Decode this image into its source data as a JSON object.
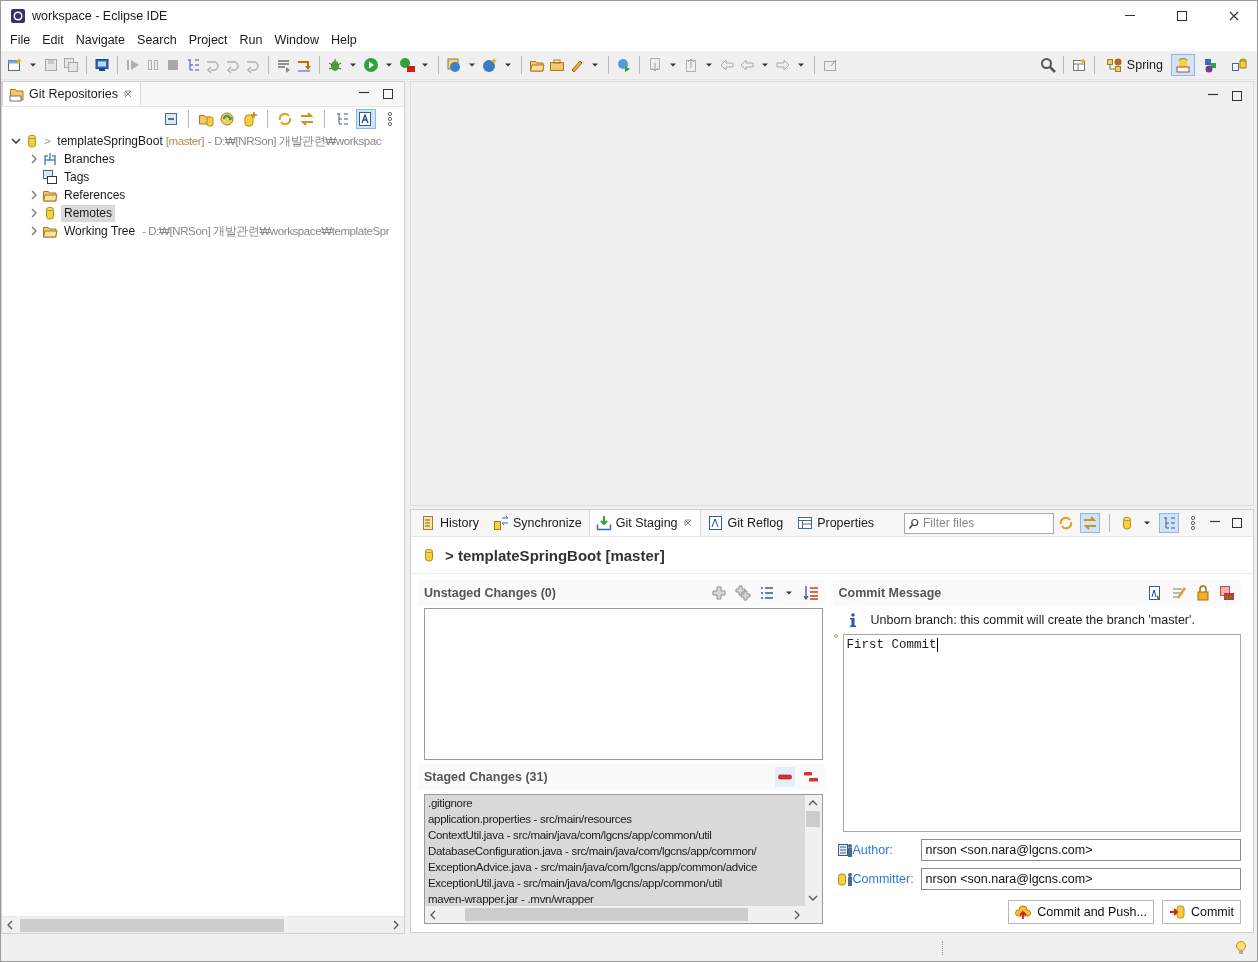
{
  "window": {
    "title": "workspace - Eclipse IDE"
  },
  "menu": [
    "File",
    "Edit",
    "Navigate",
    "Search",
    "Project",
    "Run",
    "Window",
    "Help"
  ],
  "perspectives": [
    {
      "label": "Spring",
      "selected": false,
      "kind": "spring"
    },
    {
      "selected": true,
      "kind": "git"
    },
    {
      "selected": false,
      "kind": "debug"
    },
    {
      "selected": false,
      "kind": "java"
    }
  ],
  "repositories_view": {
    "tab": {
      "label": "Git Repositories",
      "selected": true
    },
    "link_toggle_on": true,
    "tree": [
      {
        "prefix": ">",
        "label": "templateSpringBoot",
        "branch": "[master]",
        "path": "- D:₩[NRSon] 개발관련₩workspac",
        "kind": "repo",
        "expanded": true,
        "selected": false,
        "children": [
          {
            "label": "Branches",
            "kind": "branches",
            "expanded": false,
            "selected": false
          },
          {
            "label": "Tags",
            "kind": "tags",
            "selected": false
          },
          {
            "label": "References",
            "kind": "folder",
            "expanded": false,
            "selected": false
          },
          {
            "label": "Remotes",
            "kind": "remotes",
            "expanded": false,
            "selected": true
          },
          {
            "label": "Working Tree",
            "path": "- D:₩[NRSon] 개발관련₩workspace₩templateSpr",
            "kind": "folder",
            "expanded": false,
            "selected": false
          }
        ]
      }
    ]
  },
  "staging_view": {
    "tabs": [
      {
        "label": "History",
        "kind": "history",
        "selected": false
      },
      {
        "label": "Synchronize",
        "kind": "sync",
        "selected": false
      },
      {
        "label": "Git Staging",
        "kind": "staging",
        "selected": true
      },
      {
        "label": "Git Reflog",
        "kind": "reflog",
        "selected": false
      },
      {
        "label": "Properties",
        "kind": "properties",
        "selected": false
      }
    ],
    "filter": {
      "placeholder": "Filter files"
    },
    "compare_toggle_on": true,
    "presentation_toggle_on": true,
    "repository": {
      "prefix": ">",
      "label": "templateSpringBoot [master]"
    },
    "unstaged": {
      "title": "Unstaged Changes (0)"
    },
    "staged": {
      "title": "Staged Changes (31)",
      "files": [
        {
          "label": ".gitignore",
          "selected": true
        },
        {
          "label": "application.properties - src/main/resources",
          "selected": true
        },
        {
          "label": "ContextUtil.java - src/main/java/com/lgcns/app/common/util",
          "selected": true
        },
        {
          "label": "DatabaseConfiguration.java - src/main/java/com/lgcns/app/common/",
          "selected": true
        },
        {
          "label": "ExceptionAdvice.java - src/main/java/com/lgcns/app/common/advice",
          "selected": true
        },
        {
          "label": "ExceptionUtil.java - src/main/java/com/lgcns/app/common/util",
          "selected": true
        },
        {
          "label": "maven-wrapper.jar - .mvn/wrapper",
          "selected": true
        }
      ]
    },
    "commit": {
      "title": "Commit Message",
      "info": "Unborn branch: this commit will create the branch 'master'.",
      "message": "First Commit",
      "author_label": "Author:",
      "author": "nrson <son.nara@lgcns.com>",
      "committer_label": "Committer:",
      "committer": "nrson <son.nara@lgcns.com>",
      "buttons": [
        {
          "label": "Commit and Push...",
          "kind": "push"
        },
        {
          "label": "Commit",
          "kind": "commit"
        }
      ]
    }
  }
}
